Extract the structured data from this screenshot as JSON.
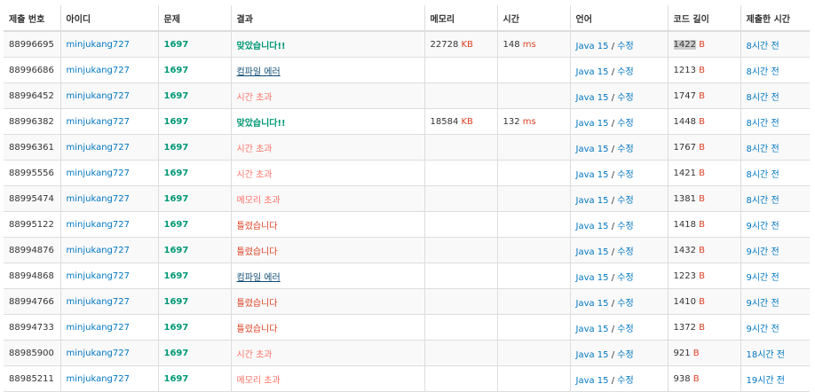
{
  "headers": [
    "제출 번호",
    "아이디",
    "문제",
    "결과",
    "메모리",
    "시간",
    "언어",
    "코드 길이",
    "제출한 시간"
  ],
  "units": {
    "memory": "KB",
    "time": "ms",
    "code": "B"
  },
  "colors": {
    "link": "#0076c0",
    "accepted": "#009874",
    "compile_error": "#0f4c75",
    "time_limit": "#fa7268",
    "wrong_answer": "#dd4124",
    "memory_limit": "#fa7268",
    "unit": "#dd4124"
  },
  "rows": [
    {
      "id": "88996695",
      "user": "minjukang727",
      "problem": "1697",
      "result": "맞았습니다!!",
      "result_type": "ac",
      "memory": "22728",
      "time": "148",
      "lang": "Java 15",
      "edit": "수정",
      "code_len": "1422",
      "submitted": "8시간 전"
    },
    {
      "id": "88996686",
      "user": "minjukang727",
      "problem": "1697",
      "result": "컴파일 에러",
      "result_type": "ce",
      "memory": "",
      "time": "",
      "lang": "Java 15",
      "edit": "수정",
      "code_len": "1213",
      "submitted": "8시간 전"
    },
    {
      "id": "88996452",
      "user": "minjukang727",
      "problem": "1697",
      "result": "시간 초과",
      "result_type": "tle",
      "memory": "",
      "time": "",
      "lang": "Java 15",
      "edit": "수정",
      "code_len": "1747",
      "submitted": "8시간 전"
    },
    {
      "id": "88996382",
      "user": "minjukang727",
      "problem": "1697",
      "result": "맞았습니다!!",
      "result_type": "ac",
      "memory": "18584",
      "time": "132",
      "lang": "Java 15",
      "edit": "수정",
      "code_len": "1448",
      "submitted": "8시간 전"
    },
    {
      "id": "88996361",
      "user": "minjukang727",
      "problem": "1697",
      "result": "시간 초과",
      "result_type": "tle",
      "memory": "",
      "time": "",
      "lang": "Java 15",
      "edit": "수정",
      "code_len": "1767",
      "submitted": "8시간 전"
    },
    {
      "id": "88995556",
      "user": "minjukang727",
      "problem": "1697",
      "result": "시간 초과",
      "result_type": "tle",
      "memory": "",
      "time": "",
      "lang": "Java 15",
      "edit": "수정",
      "code_len": "1421",
      "submitted": "8시간 전"
    },
    {
      "id": "88995474",
      "user": "minjukang727",
      "problem": "1697",
      "result": "메모리 초과",
      "result_type": "mle",
      "memory": "",
      "time": "",
      "lang": "Java 15",
      "edit": "수정",
      "code_len": "1381",
      "submitted": "8시간 전"
    },
    {
      "id": "88995122",
      "user": "minjukang727",
      "problem": "1697",
      "result": "틀렸습니다",
      "result_type": "wa",
      "memory": "",
      "time": "",
      "lang": "Java 15",
      "edit": "수정",
      "code_len": "1418",
      "submitted": "9시간 전"
    },
    {
      "id": "88994876",
      "user": "minjukang727",
      "problem": "1697",
      "result": "틀렸습니다",
      "result_type": "wa",
      "memory": "",
      "time": "",
      "lang": "Java 15",
      "edit": "수정",
      "code_len": "1432",
      "submitted": "9시간 전"
    },
    {
      "id": "88994868",
      "user": "minjukang727",
      "problem": "1697",
      "result": "컴파일 에러",
      "result_type": "ce",
      "memory": "",
      "time": "",
      "lang": "Java 15",
      "edit": "수정",
      "code_len": "1223",
      "submitted": "9시간 전"
    },
    {
      "id": "88994766",
      "user": "minjukang727",
      "problem": "1697",
      "result": "틀렸습니다",
      "result_type": "wa",
      "memory": "",
      "time": "",
      "lang": "Java 15",
      "edit": "수정",
      "code_len": "1410",
      "submitted": "9시간 전"
    },
    {
      "id": "88994733",
      "user": "minjukang727",
      "problem": "1697",
      "result": "틀렸습니다",
      "result_type": "wa",
      "memory": "",
      "time": "",
      "lang": "Java 15",
      "edit": "수정",
      "code_len": "1372",
      "submitted": "9시간 전"
    },
    {
      "id": "88985900",
      "user": "minjukang727",
      "problem": "1697",
      "result": "시간 초과",
      "result_type": "tle",
      "memory": "",
      "time": "",
      "lang": "Java 15",
      "edit": "수정",
      "code_len": "921",
      "submitted": "18시간 전"
    },
    {
      "id": "88985211",
      "user": "minjukang727",
      "problem": "1697",
      "result": "메모리 초과",
      "result_type": "mle",
      "memory": "",
      "time": "",
      "lang": "Java 15",
      "edit": "수정",
      "code_len": "938",
      "submitted": "19시간 전"
    }
  ]
}
